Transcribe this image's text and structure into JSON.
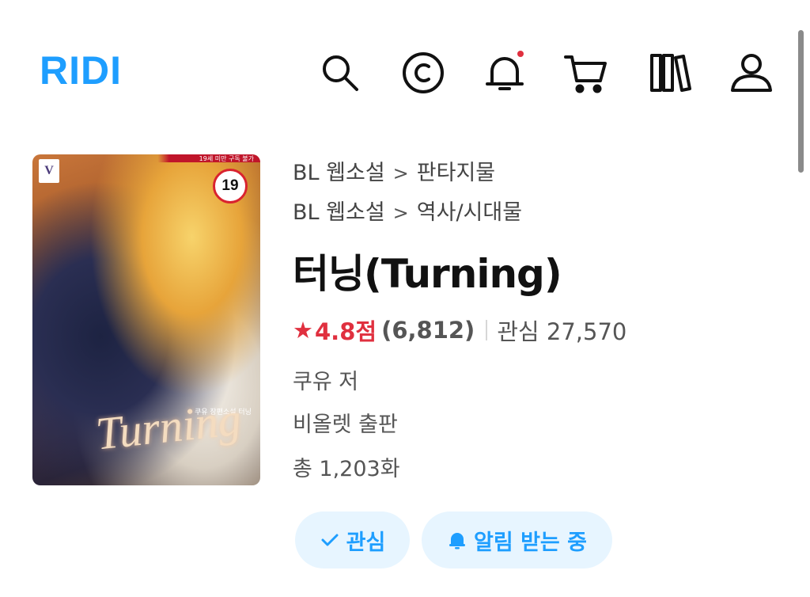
{
  "header": {
    "logo": "RIDI",
    "icons": [
      {
        "name": "search-icon"
      },
      {
        "name": "copyright-icon"
      },
      {
        "name": "bell-icon",
        "has_notification_dot": true
      },
      {
        "name": "cart-icon"
      },
      {
        "name": "library-icon"
      },
      {
        "name": "user-icon"
      }
    ],
    "accent_color": "#1e9eff",
    "notification_dot_color": "#e0303f"
  },
  "cover": {
    "publisher_mark": "V",
    "age_notice": "19세 미만 구독 불가",
    "age_badge": "19",
    "title_art": "Turning",
    "small_text": "쿠유 장편소설 터닝"
  },
  "book": {
    "categories": [
      {
        "parent": "BL 웹소설",
        "child": "판타지물"
      },
      {
        "parent": "BL 웹소설",
        "child": "역사/시대물"
      }
    ],
    "breadcrumb_separator": ">",
    "title": "터닝(Turning)",
    "rating": "4.8점",
    "rating_count": "(6,812)",
    "interest_label": "관심 27,570",
    "author": "쿠유 저",
    "publisher": "비올렛 출판",
    "episodes": "총 1,203화"
  },
  "actions": {
    "interest_button": "관심",
    "notify_button": "알림 받는 중"
  }
}
